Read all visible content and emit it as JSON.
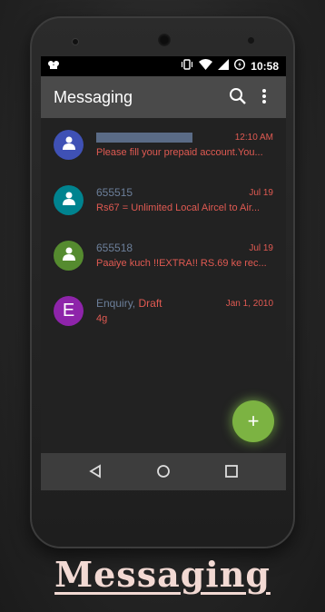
{
  "statusbar": {
    "time": "10:58",
    "icons": [
      "android-icon",
      "vibrate-icon",
      "wifi-icon",
      "signal-icon",
      "battery-icon"
    ]
  },
  "appbar": {
    "title": "Messaging",
    "icons": [
      "search-icon",
      "more-vert-icon"
    ]
  },
  "colors": {
    "accent": "#e05a52",
    "name": "#6c7f9a",
    "fab": "#7cb342",
    "appbar": "#4a4a4a"
  },
  "conversations": [
    {
      "avatar_color": "#3f51b5",
      "avatar_icon": "person-icon",
      "name": "",
      "redacted": true,
      "date": "12:10 AM",
      "snippet": "Please fill your prepaid account.You..."
    },
    {
      "avatar_color": "#00838f",
      "avatar_icon": "person-icon",
      "name": "655515",
      "date": "Jul 19",
      "snippet": "Rs67 = Unlimited Local Aircel to Air..."
    },
    {
      "avatar_color": "#558b2f",
      "avatar_icon": "person-icon",
      "name": "655518",
      "date": "Jul 19",
      "snippet": "Paaiye kuch !!EXTRA!! RS.69 ke rec..."
    },
    {
      "avatar_color": "#8e24aa",
      "avatar_letter": "E",
      "name": "Enquiry,",
      "draft": "Draft",
      "date": "Jan 1, 2010",
      "snippet": "4g"
    }
  ],
  "fab": {
    "label": "+"
  },
  "footer": {
    "title": "Messaging"
  }
}
